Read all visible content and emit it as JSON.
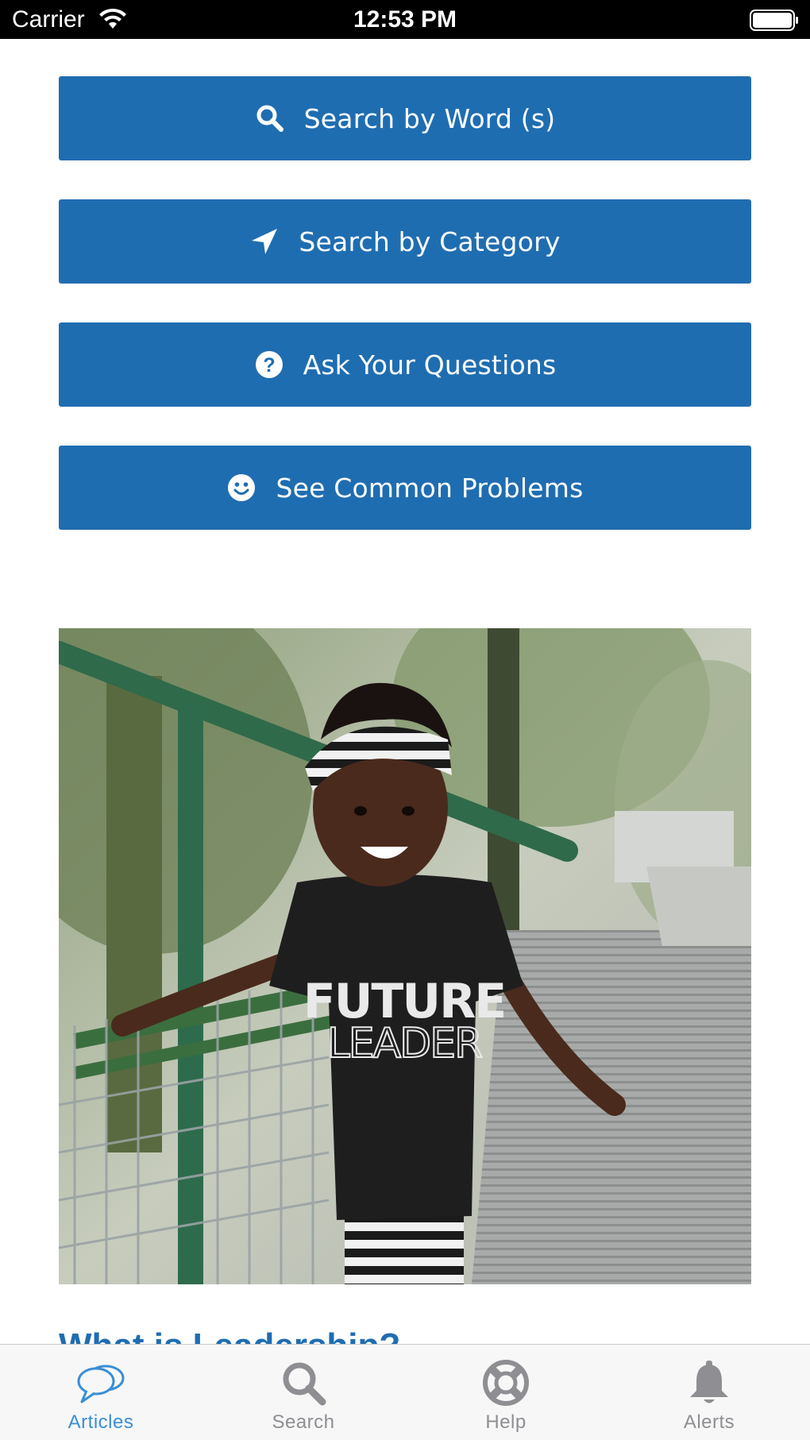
{
  "status_bar": {
    "carrier": "Carrier",
    "time": "12:53 PM"
  },
  "buttons": [
    {
      "label": "Search by Word (s)",
      "icon": "search-icon"
    },
    {
      "label": "Search by Category",
      "icon": "location-arrow-icon"
    },
    {
      "label": "Ask Your Questions",
      "icon": "question-circle-icon"
    },
    {
      "label": "See Common Problems",
      "icon": "smile-icon"
    }
  ],
  "article": {
    "title": "What is Leadership?",
    "image_shirt_text": "FUTURE LEADER"
  },
  "tab_bar": {
    "items": [
      {
        "label": "Articles",
        "icon": "chat-bubbles-icon",
        "active": true
      },
      {
        "label": "Search",
        "icon": "search-icon",
        "active": false
      },
      {
        "label": "Help",
        "icon": "lifebuoy-icon",
        "active": false
      },
      {
        "label": "Alerts",
        "icon": "bell-icon",
        "active": false
      }
    ]
  },
  "colors": {
    "button_bg": "#1f6db1",
    "active_tab": "#3a8ed6",
    "inactive_tab": "#8e8e93"
  }
}
